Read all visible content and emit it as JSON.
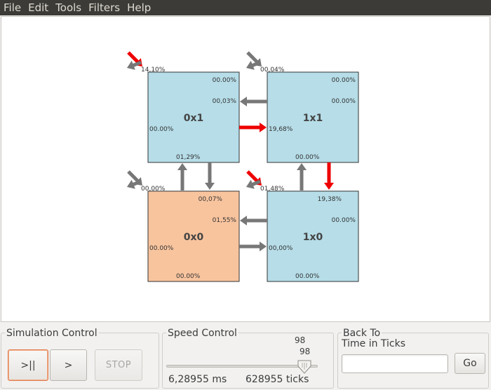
{
  "menu": [
    "File",
    "Edit",
    "Tools",
    "Filters",
    "Help"
  ],
  "grid": {
    "nodes": [
      {
        "id": "0x1",
        "color": "#b6dde8",
        "n": "00.00%",
        "e": "00,03%",
        "s": "01,29%",
        "w": "00.00%"
      },
      {
        "id": "1x1",
        "color": "#b6dde8",
        "n": "00.00%",
        "e": "00.00%",
        "s": "00.00%",
        "w": "19,68%"
      },
      {
        "id": "0x0",
        "color": "#f8c49e",
        "n": "00,07%",
        "e": "01,55%",
        "s": "00.00%",
        "w": "00.00%"
      },
      {
        "id": "1x0",
        "color": "#b6dde8",
        "n": "19,38%",
        "e": "00.00%",
        "s": "00.00%",
        "w": "00,00%"
      }
    ],
    "local": [
      "14,10%",
      "00,04%",
      "00,00%",
      "01,48%"
    ],
    "active_color": "#ee0000",
    "idle_color": "#777777"
  },
  "sim_control": {
    "title": "Simulation Control",
    "play_pause": ">||",
    "step": ">",
    "stop": "STOP"
  },
  "speed": {
    "title": "Speed Control",
    "value_top": "98",
    "value": "98",
    "ms": "6,28955 ms",
    "ticks": "628955 ticks",
    "level": 98
  },
  "back_to": {
    "title": "Back To",
    "subtitle": "Time in Ticks",
    "input_value": "",
    "go": "Go"
  }
}
